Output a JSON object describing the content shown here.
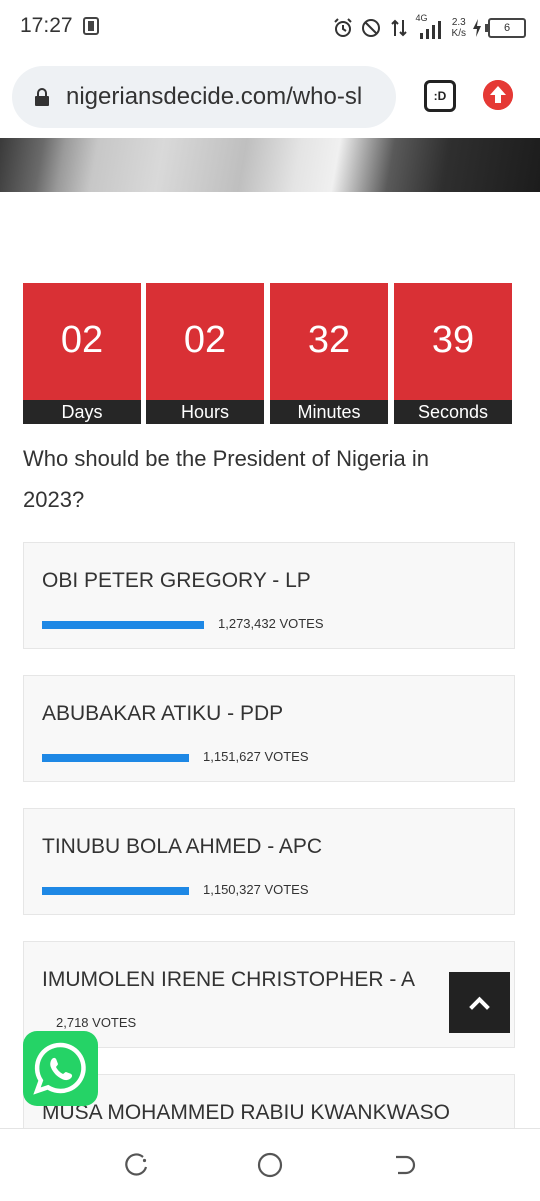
{
  "status_bar": {
    "time": "17:27",
    "net_type": "4G",
    "speed_value": "2.3",
    "speed_unit": "K/s",
    "battery": "6"
  },
  "browser": {
    "url": "nigeriansdecide.com/who-sl",
    "tab_icon_label": ":D"
  },
  "countdown": [
    {
      "value": "02",
      "label": "Days"
    },
    {
      "value": "02",
      "label": "Hours"
    },
    {
      "value": "32",
      "label": "Minutes"
    },
    {
      "value": "39",
      "label": "Seconds"
    }
  ],
  "question": "Who should be the President of Nigeria in 2023?",
  "candidates": [
    {
      "name": "OBI PETER GREGORY - LP",
      "votes": "1,273,432 VOTES",
      "share": 0.356
    },
    {
      "name": "ABUBAKAR ATIKU - PDP",
      "votes": "1,151,627 VOTES",
      "share": 0.322
    },
    {
      "name": "TINUBU BOLA AHMED - APC",
      "votes": "1,150,327 VOTES",
      "share": 0.322
    },
    {
      "name": "IMUMOLEN IRENE CHRISTOPHER - A",
      "votes": "2,718 VOTES",
      "share": 0.001
    },
    {
      "name": "MUSA MOHAMMED RABIU KWANKWASO",
      "votes": "",
      "share": 0
    }
  ],
  "colors": {
    "countdown_red": "#d93035",
    "vote_bar": "#1e88e5",
    "whatsapp_green": "#25d366"
  },
  "icons": {
    "back_to_top": "chevron-up-icon",
    "whatsapp": "whatsapp-icon"
  }
}
